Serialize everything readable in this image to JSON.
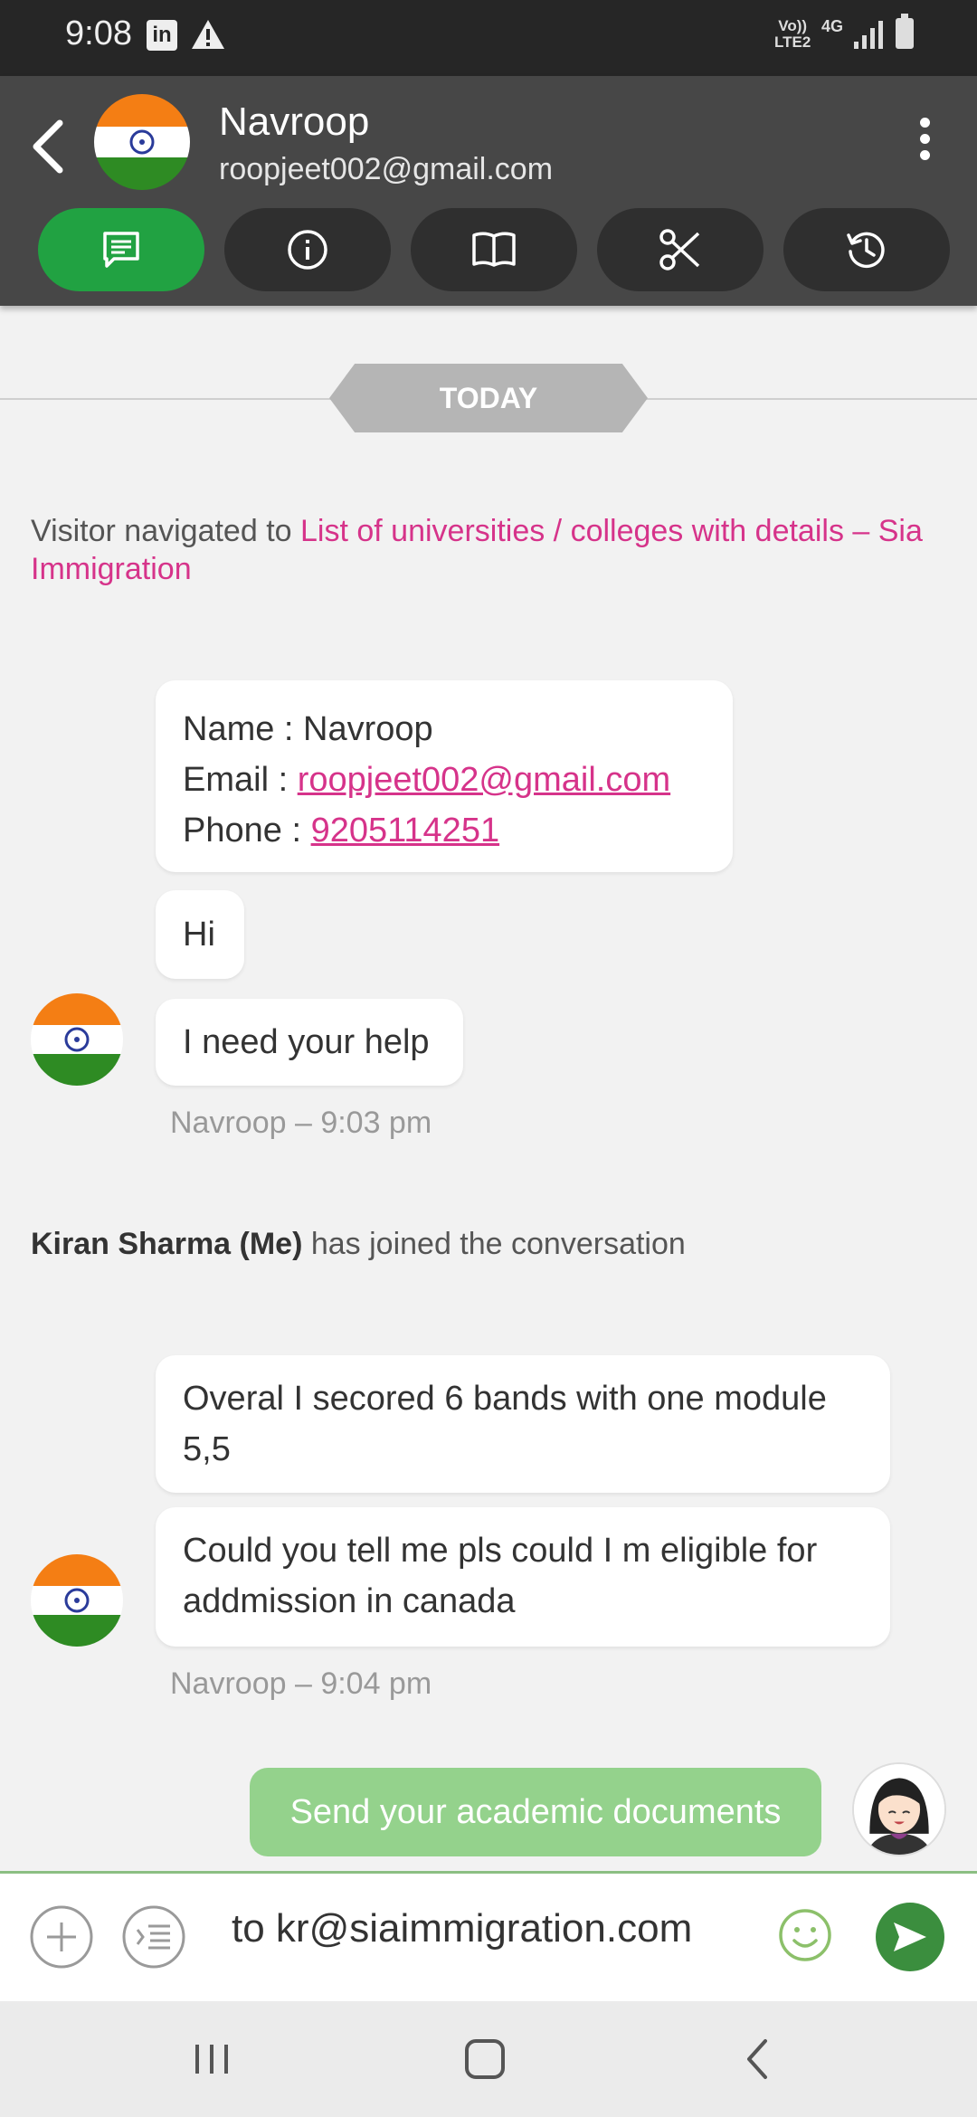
{
  "status_bar": {
    "time": "9:08",
    "linkedin_icon": "linkedin-icon",
    "warning_icon": "warning-icon",
    "volte": "Vo))",
    "lte": "LTE2",
    "network": "4G"
  },
  "header": {
    "contact_name": "Navroop",
    "contact_email": "roopjeet002@gmail.com",
    "tabs": [
      {
        "name": "chat",
        "icon": "chat-icon",
        "active": true
      },
      {
        "name": "info",
        "icon": "info-icon",
        "active": false
      },
      {
        "name": "book",
        "icon": "book-icon",
        "active": false
      },
      {
        "name": "scissors",
        "icon": "scissors-icon",
        "active": false
      },
      {
        "name": "history",
        "icon": "history-icon",
        "active": false
      }
    ]
  },
  "chat": {
    "date_divider": "TODAY",
    "visitor_nav_prefix": "Visitor navigated to ",
    "visitor_nav_link": "List of universities / colleges with details – Sia Immigration",
    "info_card": {
      "name_label": "Name : ",
      "name_value": "Navroop",
      "email_label": "Email : ",
      "email_value": "roopjeet002@gmail.com",
      "phone_label": "Phone : ",
      "phone_value": "9205114251"
    },
    "messages_group1": [
      "Hi",
      "I need your help"
    ],
    "meta_group1": "Navroop – 9:03 pm",
    "join_name": "Kiran Sharma (Me)",
    "join_text": " has joined the conversation",
    "messages_group2": [
      "Overal I secored 6 bands with one module 5,5",
      "Could you tell me pls could I m eligible for addmission in canada"
    ],
    "meta_group2": "Navroop – 9:04 pm",
    "agent_message": "Send your academic documents"
  },
  "composer": {
    "input_value": "to kr@siaimmigration.com"
  },
  "colors": {
    "accent_green": "#21a242",
    "link_pink": "#d6338a",
    "agent_bubble": "#94d28c",
    "header_bg": "#474747"
  }
}
